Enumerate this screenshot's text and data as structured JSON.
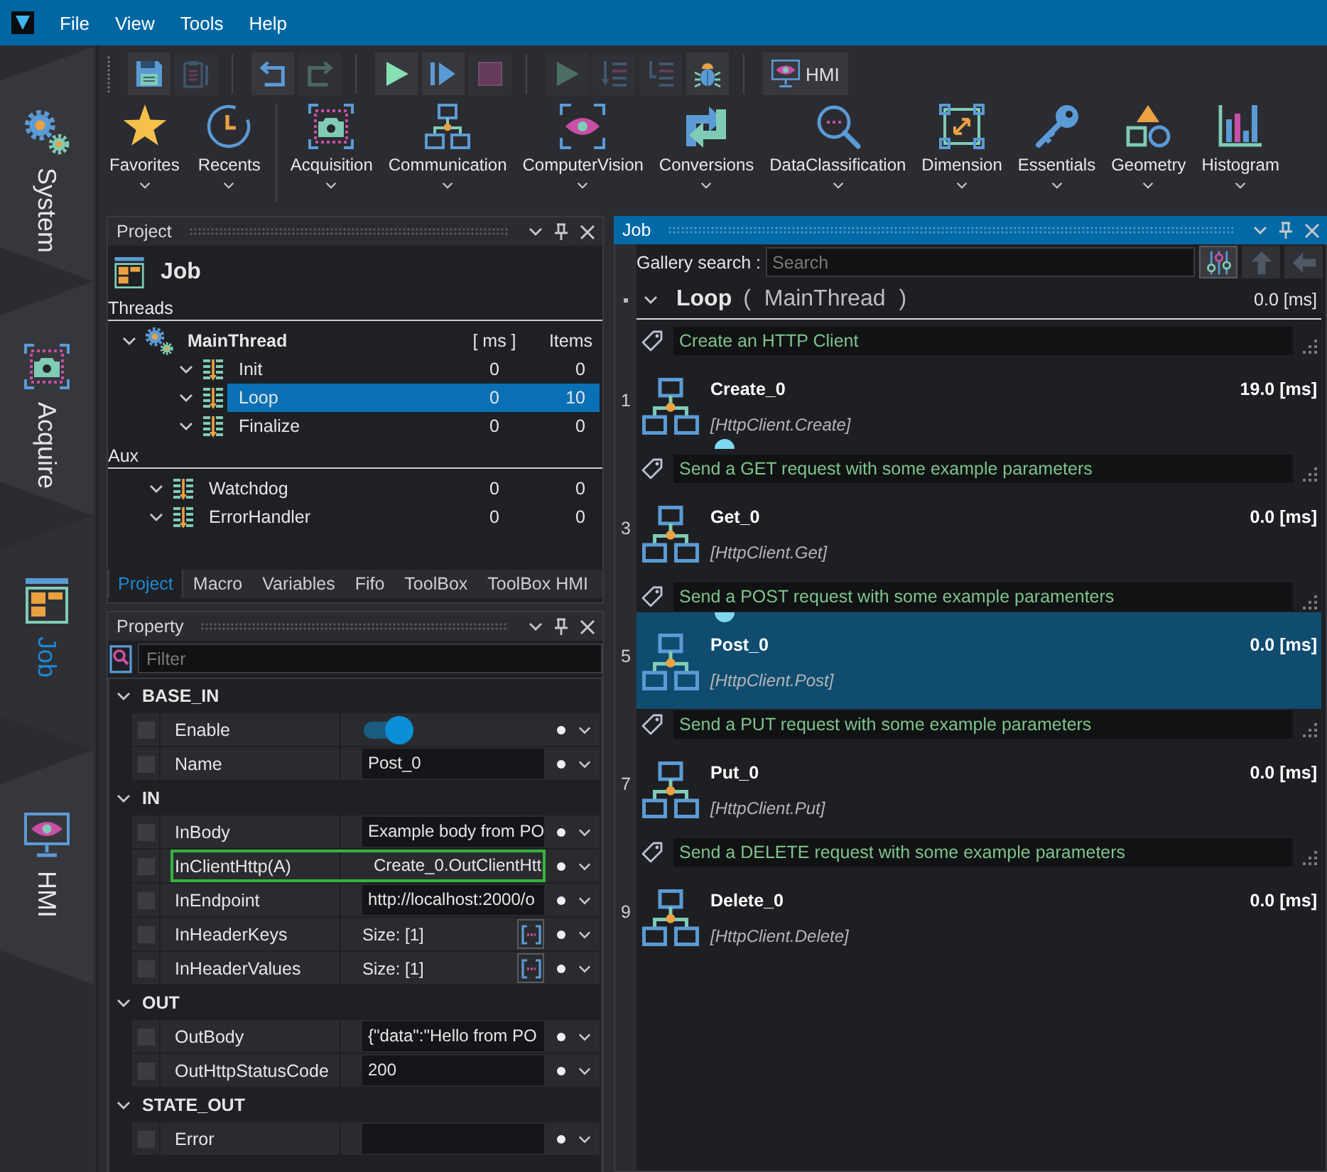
{
  "menu_bar": {
    "items": [
      "File",
      "View",
      "Tools",
      "Help"
    ]
  },
  "side_tabs": [
    {
      "label": "System",
      "selected": false
    },
    {
      "label": "Acquire",
      "selected": false
    },
    {
      "label": "Job",
      "selected": true
    },
    {
      "label": "HMI",
      "selected": false
    }
  ],
  "toolbar": {
    "groups": [
      {
        "buttons": [
          {
            "kind": "save",
            "disabled": false
          },
          {
            "kind": "paste",
            "disabled": true
          }
        ]
      },
      {
        "buttons": [
          {
            "kind": "undo",
            "disabled": false
          },
          {
            "kind": "redo",
            "disabled": true
          }
        ]
      },
      {
        "buttons": [
          {
            "kind": "run",
            "disabled": false
          },
          {
            "kind": "step",
            "disabled": false
          },
          {
            "kind": "stop",
            "disabled": true
          }
        ]
      },
      {
        "buttons": [
          {
            "kind": "run",
            "disabled": true
          },
          {
            "kind": "indent",
            "disabled": true
          },
          {
            "kind": "outdent",
            "disabled": true
          },
          {
            "kind": "debug",
            "disabled": false
          }
        ]
      },
      {
        "buttons": [
          {
            "kind": "hmi",
            "label": "HMI",
            "disabled": false
          }
        ]
      }
    ],
    "category_groups": [
      {
        "items": [
          "Favorites",
          "Recents"
        ]
      },
      {
        "items": [
          "Acquisition",
          "Communication",
          "ComputerVision",
          "Conversions",
          "DataClassification",
          "Dimension",
          "Essentials",
          "Geometry",
          "Histogram"
        ]
      }
    ]
  },
  "project_panel": {
    "title": "Project",
    "active": false,
    "heading": "Job",
    "sections": [
      {
        "label": "Threads",
        "rows": [
          {
            "kind": "group",
            "label": "MainThread",
            "columns": [
              "[ ms ]",
              "Items"
            ],
            "expanded": true,
            "selected": false,
            "children": [
              {
                "kind": "thread",
                "label": "Init",
                "ms": "0",
                "items": "0",
                "expanded": true,
                "selected": false
              },
              {
                "kind": "thread",
                "label": "Loop",
                "ms": "0",
                "items": "10",
                "expanded": true,
                "selected": true
              },
              {
                "kind": "thread",
                "label": "Finalize",
                "ms": "0",
                "items": "0",
                "expanded": true,
                "selected": false
              }
            ]
          }
        ]
      },
      {
        "label": "Aux",
        "rows": [
          {
            "kind": "thread",
            "label": "Watchdog",
            "ms": "0",
            "items": "0",
            "expanded": true,
            "selected": false
          },
          {
            "kind": "thread",
            "label": "ErrorHandler",
            "ms": "0",
            "items": "0",
            "expanded": true,
            "selected": false
          }
        ]
      }
    ],
    "tabs": [
      {
        "label": "Project",
        "selected": true
      },
      {
        "label": "Macro",
        "selected": false
      },
      {
        "label": "Variables",
        "selected": false
      },
      {
        "label": "Fifo",
        "selected": false
      },
      {
        "label": "ToolBox",
        "selected": false
      },
      {
        "label": "ToolBox HMI",
        "selected": false
      }
    ]
  },
  "property_panel": {
    "title": "Property",
    "active": false,
    "filter": {
      "placeholder": "Filter"
    },
    "groups": [
      {
        "label": "BASE_IN",
        "expanded": true,
        "rows": [
          {
            "name": "Enable",
            "kind": "toggle",
            "on": true,
            "checked": false,
            "highlighted": false
          },
          {
            "name": "Name",
            "kind": "text",
            "value": "Post_0",
            "checked": false,
            "highlighted": false
          }
        ]
      },
      {
        "label": "IN",
        "expanded": true,
        "rows": [
          {
            "name": "InBody",
            "kind": "text",
            "value": "Example body from PO",
            "checked": false,
            "highlighted": false
          },
          {
            "name": "InClientHttp(A)",
            "kind": "text",
            "value": "Create_0.OutClientHtt",
            "checked": false,
            "highlighted": true
          },
          {
            "name": "InEndpoint",
            "kind": "text",
            "value": "http://localhost:2000/o",
            "checked": false,
            "highlighted": false
          },
          {
            "name": "InHeaderKeys",
            "kind": "array",
            "value": "Size: [1]",
            "checked": false,
            "highlighted": false
          },
          {
            "name": "InHeaderValues",
            "kind": "array",
            "value": "Size: [1]",
            "checked": false,
            "highlighted": false
          }
        ]
      },
      {
        "label": "OUT",
        "expanded": true,
        "rows": [
          {
            "name": "OutBody",
            "kind": "text",
            "value": "{\"data\":\"Hello from PO",
            "checked": false,
            "highlighted": false
          },
          {
            "name": "OutHttpStatusCode",
            "kind": "text",
            "value": "200",
            "checked": false,
            "highlighted": false
          }
        ]
      },
      {
        "label": "STATE_OUT",
        "expanded": true,
        "rows": [
          {
            "name": "Error",
            "kind": "text",
            "checked": false,
            "highlighted": false
          }
        ]
      }
    ]
  },
  "job_panel": {
    "title": "Job",
    "active": true,
    "search": {
      "label": "Gallery search :",
      "placeholder": "Search"
    },
    "search_buttons": [
      {
        "kind": "filter",
        "disabled": false
      },
      {
        "kind": "up",
        "disabled": true
      },
      {
        "kind": "back",
        "disabled": true
      }
    ],
    "loop": {
      "name": "Loop",
      "thread": "( MainThread )",
      "time": "0.0 [ms]",
      "expanded": true
    },
    "steps": [
      {
        "kind": "comment",
        "text": "Create an HTTP Client"
      },
      {
        "kind": "tool",
        "line": "1",
        "name": "Create_0",
        "type": "[HttpClient.Create]",
        "time": "19.0 [ms]",
        "selected": false,
        "port_in": false,
        "port_out": true
      },
      {
        "kind": "comment",
        "text": "Send a GET request with some example parameters"
      },
      {
        "kind": "tool",
        "line": "3",
        "name": "Get_0",
        "type": "[HttpClient.Get]",
        "time": "0.0 [ms]",
        "selected": false,
        "port_in": false,
        "port_out": false
      },
      {
        "kind": "comment",
        "text": "Send a POST request with some example paramenters"
      },
      {
        "kind": "tool",
        "line": "5",
        "name": "Post_0",
        "type": "[HttpClient.Post]",
        "time": "0.0 [ms]",
        "selected": true,
        "port_in": true,
        "port_out": false
      },
      {
        "kind": "comment",
        "text": "Send a PUT request with some example parameters"
      },
      {
        "kind": "tool",
        "line": "7",
        "name": "Put_0",
        "type": "[HttpClient.Put]",
        "time": "0.0 [ms]",
        "selected": false,
        "port_in": false,
        "port_out": false
      },
      {
        "kind": "comment",
        "text": "Send a DELETE request with some example parameters"
      },
      {
        "kind": "tool",
        "line": "9",
        "name": "Delete_0",
        "type": "[HttpClient.Delete]",
        "time": "0.0 [ms]",
        "selected": false,
        "port_in": false,
        "port_out": false
      }
    ]
  }
}
